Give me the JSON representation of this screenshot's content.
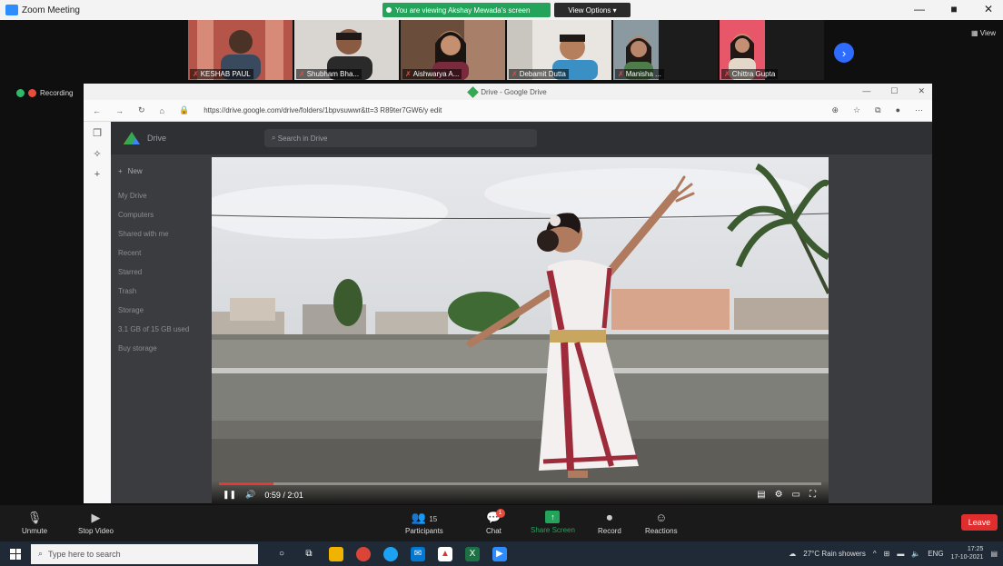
{
  "zoom": {
    "title": "Zoom Meeting",
    "share_banner": "You are viewing Akshay Mewada's screen",
    "view_options": "View Options",
    "view_toggle": "View",
    "next_icon": "chevron-right-icon",
    "recording_label": "Recording",
    "participants": [
      {
        "name": "KESHAB PAUL"
      },
      {
        "name": "Shubham Bha..."
      },
      {
        "name": "Aishwarya A..."
      },
      {
        "name": "Debamit Dutta"
      },
      {
        "name": "Manisha ..."
      },
      {
        "name": "Chittra Gupta"
      }
    ],
    "controls": {
      "unmute": "Unmute",
      "stop_video": "Stop Video",
      "participants": "Participants",
      "participants_count": "15",
      "chat": "Chat",
      "chat_badge": "1",
      "share_screen": "Share Screen",
      "record": "Record",
      "reactions": "Reactions",
      "leave": "Leave"
    }
  },
  "browser": {
    "tab_title": "Drive - Google Drive",
    "url": "https://drive.google.com/drive/folders/1bpvsuwwr&tt=3 R89ter7GW6/y edit",
    "win_controls": [
      "—",
      "☐",
      "✕"
    ]
  },
  "drive": {
    "brand": "Drive",
    "search_placeholder": "Search in Drive",
    "new_label": "New",
    "nav": [
      "My Drive",
      "Computers",
      "Shared with me",
      "Recent",
      "Starred",
      "Trash",
      "Storage"
    ],
    "storage_text": "3.1 GB of 15 GB used",
    "buy_storage": "Buy storage"
  },
  "player": {
    "time": "0:59 / 2:01",
    "progress": 0.09
  },
  "taskbar": {
    "search_placeholder": "Type here to search",
    "weather": "27°C Rain showers",
    "lang": "ENG",
    "time": "17:25",
    "date": "17-10-2021"
  },
  "colors": {
    "zoom_green": "#23a45a",
    "leave_red": "#e02d2d",
    "progress_red": "#e53935"
  }
}
